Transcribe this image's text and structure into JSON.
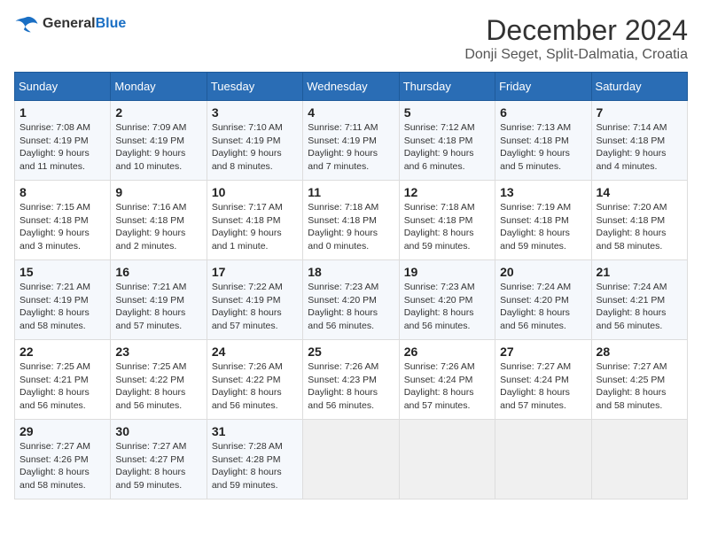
{
  "header": {
    "logo_general": "General",
    "logo_blue": "Blue",
    "month_title": "December 2024",
    "location": "Donji Seget, Split-Dalmatia, Croatia"
  },
  "days_of_week": [
    "Sunday",
    "Monday",
    "Tuesday",
    "Wednesday",
    "Thursday",
    "Friday",
    "Saturday"
  ],
  "weeks": [
    [
      {
        "day": "1",
        "sunrise": "7:08 AM",
        "sunset": "4:19 PM",
        "daylight": "9 hours and 11 minutes."
      },
      {
        "day": "2",
        "sunrise": "7:09 AM",
        "sunset": "4:19 PM",
        "daylight": "9 hours and 10 minutes."
      },
      {
        "day": "3",
        "sunrise": "7:10 AM",
        "sunset": "4:19 PM",
        "daylight": "9 hours and 8 minutes."
      },
      {
        "day": "4",
        "sunrise": "7:11 AM",
        "sunset": "4:19 PM",
        "daylight": "9 hours and 7 minutes."
      },
      {
        "day": "5",
        "sunrise": "7:12 AM",
        "sunset": "4:18 PM",
        "daylight": "9 hours and 6 minutes."
      },
      {
        "day": "6",
        "sunrise": "7:13 AM",
        "sunset": "4:18 PM",
        "daylight": "9 hours and 5 minutes."
      },
      {
        "day": "7",
        "sunrise": "7:14 AM",
        "sunset": "4:18 PM",
        "daylight": "9 hours and 4 minutes."
      }
    ],
    [
      {
        "day": "8",
        "sunrise": "7:15 AM",
        "sunset": "4:18 PM",
        "daylight": "9 hours and 3 minutes."
      },
      {
        "day": "9",
        "sunrise": "7:16 AM",
        "sunset": "4:18 PM",
        "daylight": "9 hours and 2 minutes."
      },
      {
        "day": "10",
        "sunrise": "7:17 AM",
        "sunset": "4:18 PM",
        "daylight": "9 hours and 1 minute."
      },
      {
        "day": "11",
        "sunrise": "7:18 AM",
        "sunset": "4:18 PM",
        "daylight": "9 hours and 0 minutes."
      },
      {
        "day": "12",
        "sunrise": "7:18 AM",
        "sunset": "4:18 PM",
        "daylight": "8 hours and 59 minutes."
      },
      {
        "day": "13",
        "sunrise": "7:19 AM",
        "sunset": "4:18 PM",
        "daylight": "8 hours and 59 minutes."
      },
      {
        "day": "14",
        "sunrise": "7:20 AM",
        "sunset": "4:18 PM",
        "daylight": "8 hours and 58 minutes."
      }
    ],
    [
      {
        "day": "15",
        "sunrise": "7:21 AM",
        "sunset": "4:19 PM",
        "daylight": "8 hours and 58 minutes."
      },
      {
        "day": "16",
        "sunrise": "7:21 AM",
        "sunset": "4:19 PM",
        "daylight": "8 hours and 57 minutes."
      },
      {
        "day": "17",
        "sunrise": "7:22 AM",
        "sunset": "4:19 PM",
        "daylight": "8 hours and 57 minutes."
      },
      {
        "day": "18",
        "sunrise": "7:23 AM",
        "sunset": "4:20 PM",
        "daylight": "8 hours and 56 minutes."
      },
      {
        "day": "19",
        "sunrise": "7:23 AM",
        "sunset": "4:20 PM",
        "daylight": "8 hours and 56 minutes."
      },
      {
        "day": "20",
        "sunrise": "7:24 AM",
        "sunset": "4:20 PM",
        "daylight": "8 hours and 56 minutes."
      },
      {
        "day": "21",
        "sunrise": "7:24 AM",
        "sunset": "4:21 PM",
        "daylight": "8 hours and 56 minutes."
      }
    ],
    [
      {
        "day": "22",
        "sunrise": "7:25 AM",
        "sunset": "4:21 PM",
        "daylight": "8 hours and 56 minutes."
      },
      {
        "day": "23",
        "sunrise": "7:25 AM",
        "sunset": "4:22 PM",
        "daylight": "8 hours and 56 minutes."
      },
      {
        "day": "24",
        "sunrise": "7:26 AM",
        "sunset": "4:22 PM",
        "daylight": "8 hours and 56 minutes."
      },
      {
        "day": "25",
        "sunrise": "7:26 AM",
        "sunset": "4:23 PM",
        "daylight": "8 hours and 56 minutes."
      },
      {
        "day": "26",
        "sunrise": "7:26 AM",
        "sunset": "4:24 PM",
        "daylight": "8 hours and 57 minutes."
      },
      {
        "day": "27",
        "sunrise": "7:27 AM",
        "sunset": "4:24 PM",
        "daylight": "8 hours and 57 minutes."
      },
      {
        "day": "28",
        "sunrise": "7:27 AM",
        "sunset": "4:25 PM",
        "daylight": "8 hours and 58 minutes."
      }
    ],
    [
      {
        "day": "29",
        "sunrise": "7:27 AM",
        "sunset": "4:26 PM",
        "daylight": "8 hours and 58 minutes."
      },
      {
        "day": "30",
        "sunrise": "7:27 AM",
        "sunset": "4:27 PM",
        "daylight": "8 hours and 59 minutes."
      },
      {
        "day": "31",
        "sunrise": "7:28 AM",
        "sunset": "4:28 PM",
        "daylight": "8 hours and 59 minutes."
      },
      null,
      null,
      null,
      null
    ]
  ]
}
